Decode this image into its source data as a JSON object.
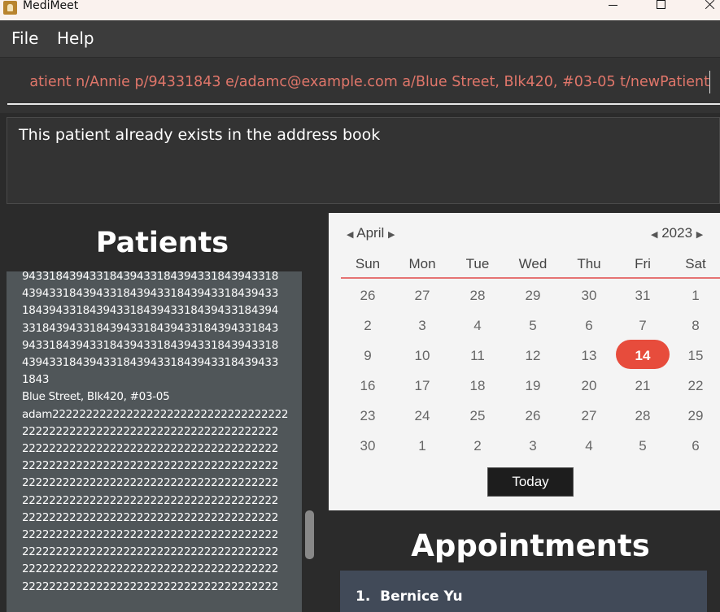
{
  "window": {
    "title": "MediMeet"
  },
  "menu": {
    "file": "File",
    "help": "Help"
  },
  "command": {
    "value": "atient n/Annie p/94331843 e/adamc@example.com a/Blue Street, Blk420, #03-05 t/newPatient"
  },
  "result": {
    "message": "This patient already exists in the address book"
  },
  "patients": {
    "title": "Patients",
    "lines": [
      "94331843943318439433184394331843943318",
      "43943318439433184394331843943318439433",
      "18439433184394331843943318439433184394",
      "33184394331843943318439433184394331843",
      "94331843943318439433184394331843943318",
      "43943318439433184394331843943318439433",
      "1843",
      "Blue Street, Blk420, #03-05",
      "adam22222222222222222222222222222222222",
      "22222222222222222222222222222222222222",
      "22222222222222222222222222222222222222",
      "22222222222222222222222222222222222222",
      "22222222222222222222222222222222222222",
      "22222222222222222222222222222222222222",
      "22222222222222222222222222222222222222",
      "22222222222222222222222222222222222222",
      "22222222222222222222222222222222222222",
      "22222222222222222222222222222222222222",
      "22222222222222222222222222222222222222"
    ]
  },
  "calendar": {
    "month": "April",
    "year": "2023",
    "weekdays": [
      "Sun",
      "Mon",
      "Tue",
      "Wed",
      "Thu",
      "Fri",
      "Sat"
    ],
    "weeks": [
      [
        "26",
        "27",
        "28",
        "29",
        "30",
        "31",
        "1"
      ],
      [
        "2",
        "3",
        "4",
        "5",
        "6",
        "7",
        "8"
      ],
      [
        "9",
        "10",
        "11",
        "12",
        "13",
        "14",
        "15"
      ],
      [
        "16",
        "17",
        "18",
        "19",
        "20",
        "21",
        "22"
      ],
      [
        "23",
        "24",
        "25",
        "26",
        "27",
        "28",
        "29"
      ],
      [
        "30",
        "1",
        "2",
        "3",
        "4",
        "5",
        "6"
      ]
    ],
    "today_label": "Today",
    "selected_day": "14",
    "accent_color": "#e74c3c"
  },
  "appointments": {
    "title": "Appointments",
    "items": [
      {
        "index": "1.",
        "name": "Bernice Yu"
      }
    ]
  }
}
